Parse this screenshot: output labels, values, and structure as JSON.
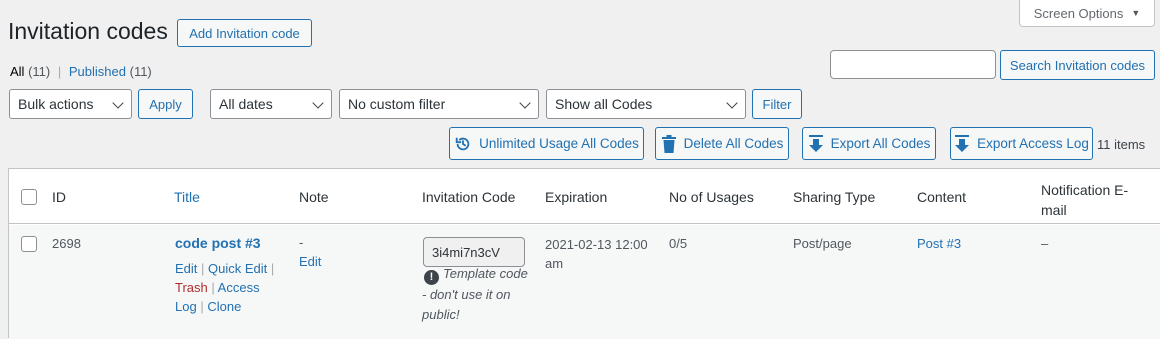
{
  "screen_options": {
    "label": "Screen Options",
    "arrow": "▼"
  },
  "page_title": "Invitation codes",
  "add_button": "Add Invitation code",
  "views": {
    "all_label": "All",
    "all_count": "(11)",
    "separator": "|",
    "published_label": "Published",
    "published_count": "(11)"
  },
  "search": {
    "placeholder": "",
    "button": "Search Invitation codes"
  },
  "filters": {
    "bulk_actions": "Bulk actions",
    "apply": "Apply",
    "dates": "All dates",
    "custom_filter": "No custom filter",
    "codes": "Show all Codes",
    "filter": "Filter"
  },
  "tools": {
    "unlimited": "Unlimited Usage All Codes",
    "delete": "Delete All Codes",
    "export_codes": "Export All Codes",
    "export_log": "Export Access Log",
    "items_count": "11 items"
  },
  "table": {
    "columns": {
      "id": "ID",
      "title": "Title",
      "note": "Note",
      "code": "Invitation Code",
      "expiration": "Expiration",
      "usages": "No of Usages",
      "sharing": "Sharing Type",
      "content": "Content",
      "notification_line1": "Notification E-",
      "notification_line2": "mail"
    },
    "rows": [
      {
        "id": "2698",
        "title": "code post #3",
        "note_dash": "-",
        "note_edit": "Edit",
        "code": "3i4mi7n3cV",
        "code_note": "Template code - don't use it on public!",
        "expiration_line1": "2021-02-13 12:00",
        "expiration_line2": "am",
        "usages": "0/5",
        "sharing": "Post/page",
        "content": "Post #3",
        "notification": "–",
        "actions": {
          "edit": "Edit",
          "quick_edit": "Quick Edit",
          "trash": "Trash",
          "access_log_1": "Access",
          "access_log_2": "Log",
          "clone": "Clone",
          "pipe": "|"
        }
      }
    ]
  },
  "colors": {
    "accent": "#2271b1",
    "trash": "#b32d2e",
    "background": "#f0f0f1"
  }
}
